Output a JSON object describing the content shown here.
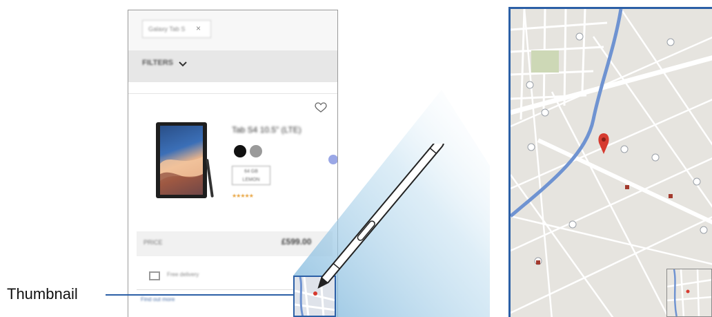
{
  "callout": {
    "label": "Thumbnail"
  },
  "browser": {
    "search_chip": "Galaxy Tab S",
    "chip_close": "×",
    "filters_label": "FILTERS",
    "filters_chevron": "⌄"
  },
  "product": {
    "title": "Tab S4 10.5\" (LTE)",
    "storage_option": "64 GB",
    "storage_sub": "LEMON",
    "stars": "★★★★★",
    "price_label": "PRICE",
    "price_value": "£599.00",
    "delivery_text": "Free delivery",
    "link_text": "Find out more"
  },
  "icons": [
    "heart-icon",
    "chevron-down-icon",
    "close-icon",
    "stylus-pen-icon",
    "map-pin-icon",
    "shop-icon",
    "home-icon"
  ],
  "colors": {
    "accent": "#2b5fa6",
    "map_background": "#e6e4df",
    "water": "#6f93d1",
    "pin": "#d63b30"
  }
}
